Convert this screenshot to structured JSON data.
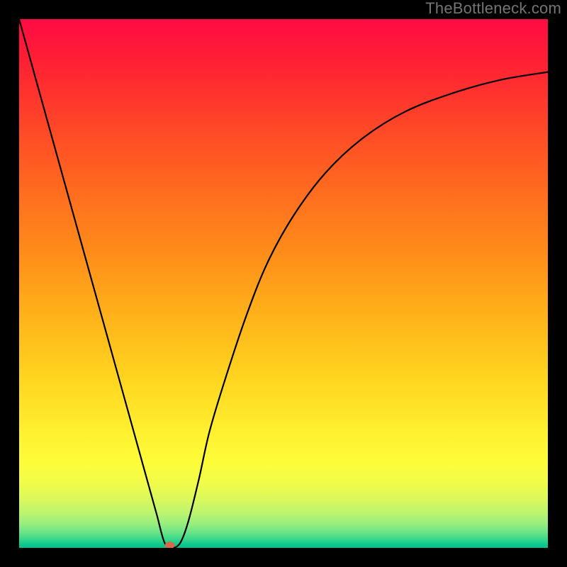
{
  "watermark": "TheBottleneck.com",
  "chart_data": {
    "type": "line",
    "title": "",
    "xlabel": "",
    "ylabel": "",
    "xlim": [
      0,
      100
    ],
    "ylim": [
      0,
      100
    ],
    "grid": false,
    "series": [
      {
        "name": "curve",
        "color": "#000000",
        "x_percent": [
          0,
          5,
          10,
          15,
          20,
          24,
          26,
          27.5,
          29,
          30.5,
          32,
          34,
          36,
          39,
          43,
          47,
          52,
          58,
          65,
          73,
          82,
          91,
          100
        ],
        "y_percent_from_bottom": [
          100,
          82,
          64,
          46,
          28,
          13.6,
          6.4,
          1,
          0,
          1,
          5,
          13,
          22,
          32,
          44,
          54,
          63,
          71,
          77.5,
          82.5,
          86,
          88.5,
          90
        ]
      }
    ],
    "marker": {
      "name": "min-point",
      "x_percent": 28.5,
      "y_percent_from_bottom": 0.5,
      "color": "#d46a4a"
    },
    "background_gradient": {
      "top": "#ff0b45",
      "bottom": "#00c28c",
      "direction": "vertical"
    }
  }
}
